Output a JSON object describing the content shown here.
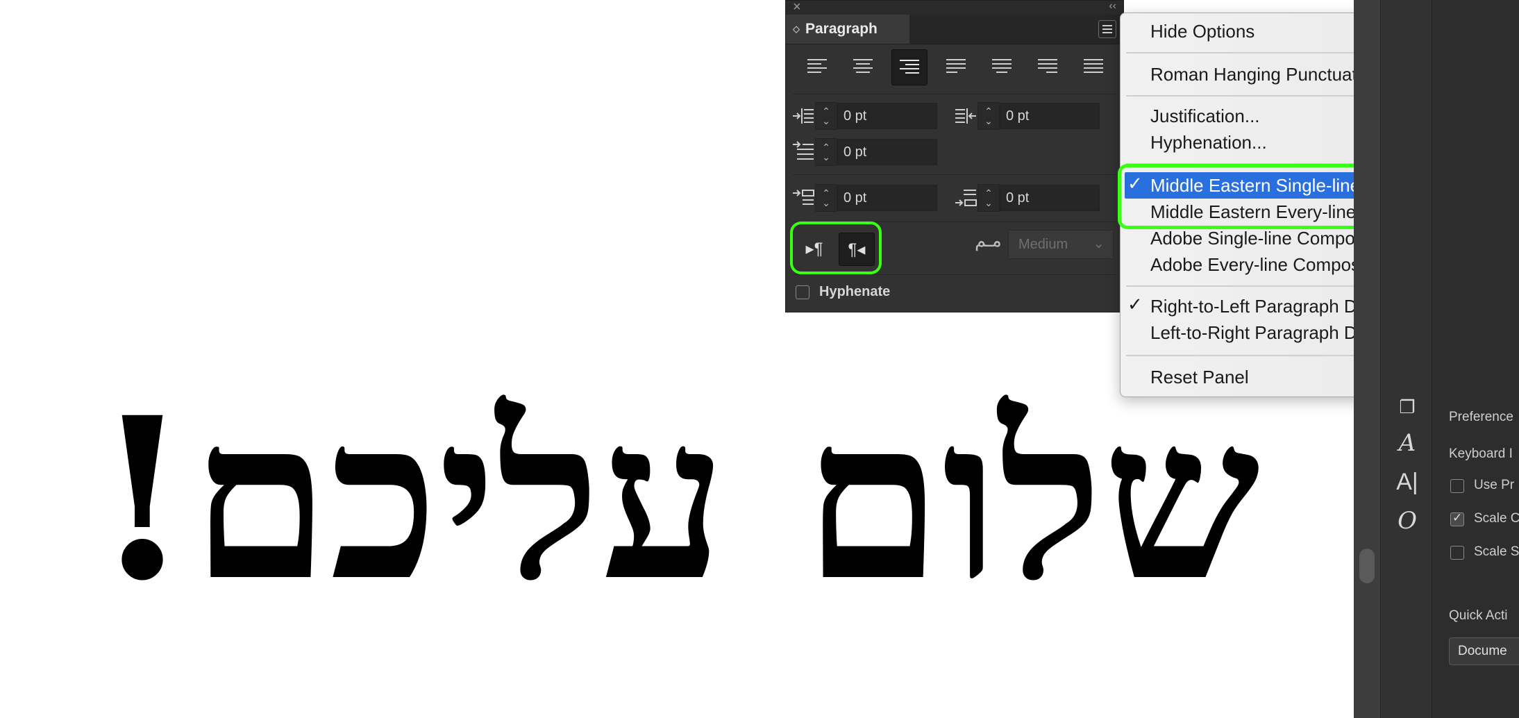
{
  "canvas": {
    "text": "שלום עליכם!"
  },
  "paragraph_panel": {
    "tab_label": "Paragraph",
    "fields": {
      "left_indent": "0 pt",
      "right_indent": "0 pt",
      "first_line_indent": "0 pt",
      "space_before": "0 pt",
      "space_after": "0 pt"
    },
    "kashida_value": "Medium",
    "hyphenate_label": "Hyphenate",
    "hyphenate_checked": false,
    "alignment_selected": "align-right",
    "direction_selected": "right-to-left"
  },
  "flyout_menu": {
    "hide_options": "Hide Options",
    "roman_hanging": "Roman Hanging Punctuation",
    "justification": "Justification...",
    "hyphenation": "Hyphenation...",
    "me_single": "Middle Eastern Single-line Composer",
    "me_every": "Middle Eastern Every-line Composer",
    "adobe_single": "Adobe Single-line Composer",
    "adobe_every": "Adobe Every-line Composer",
    "rtl_direction": "Right-to-Left Paragraph Direction",
    "ltr_direction": "Left-to-Right Paragraph Direction",
    "reset_panel": "Reset Panel",
    "check_glyph": "✓",
    "highlight_color": "#2a6fde",
    "annotation_color": "#39ff14"
  },
  "properties_panel": {
    "preferences": "Preference",
    "keyboard": "Keyboard I",
    "use_preview": "Use Pr",
    "scale_corners": "Scale C",
    "scale_strokes": "Scale S",
    "scale_corners_checked": true,
    "quick_actions": "Quick Acti",
    "document_button": "Docume"
  },
  "dock_icons": [
    "character-styles-icon",
    "type-a-icon",
    "type-cursor-icon",
    "opentype-icon"
  ]
}
